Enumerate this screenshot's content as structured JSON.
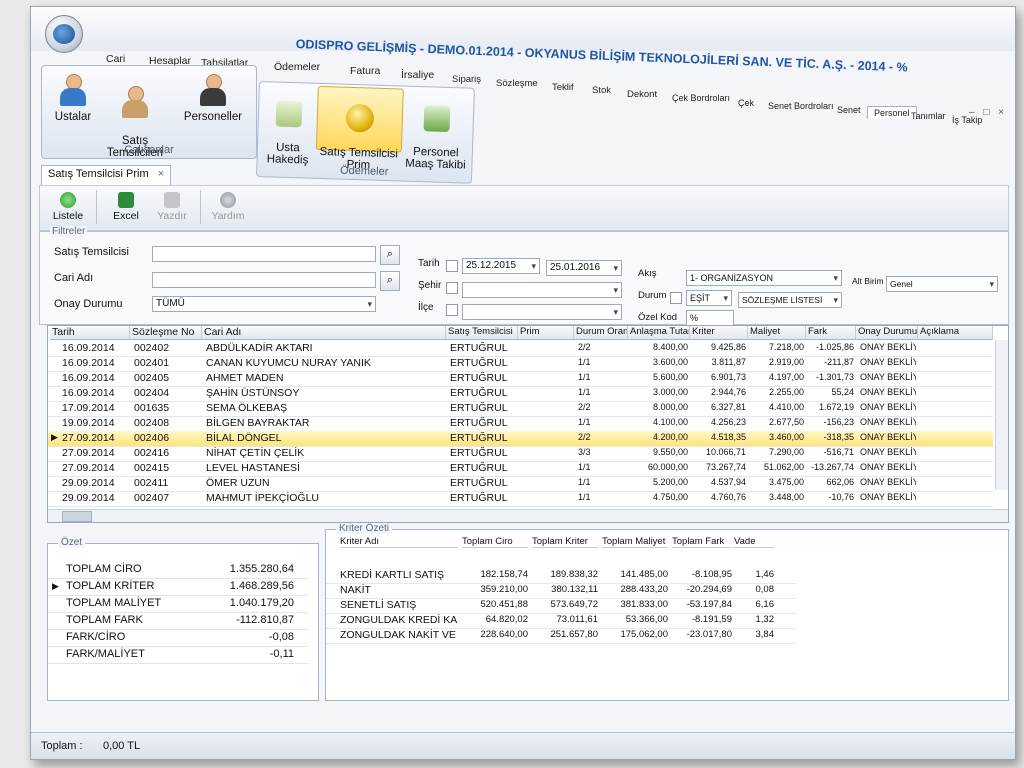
{
  "title": "ODISPRO GELİŞMİŞ - DEMO.01.2014 - OKYANUS BİLİŞİM TEKNOLOJİLERİ SAN. VE TİC. A.Ş. - 2014 - %",
  "window_controls": "– □ ×",
  "main_tabs": [
    "Cari",
    "Hesaplar",
    "Tahsilatlar",
    "Ödemeler",
    "Fatura",
    "İrsaliye",
    "Sipariş",
    "Sözleşme",
    "Teklif",
    "Stok",
    "Dekont",
    "Çek Bordroları",
    "Çek",
    "Senet Bordroları",
    "Senet",
    "Personel",
    "Tanımlar",
    "İş Takip"
  ],
  "active_main_tab": "Personel",
  "ribbon": {
    "group1": {
      "label": "Çalışanlar",
      "buttons": [
        "Ustalar",
        "Satış\nTemsilcileri",
        "Personeller"
      ]
    },
    "group2": {
      "label": "Ödemeler",
      "buttons": [
        "Usta\nHakediş",
        "Satış Temsilcisi\nPrim",
        "Personel\nMaaş Takibi"
      ]
    }
  },
  "doc_tab": {
    "label": "Satış Temsilcisi Prim",
    "close": "×"
  },
  "toolbar": {
    "list": "Listele",
    "excel": "Excel",
    "print": "Yazdır",
    "help": "Yardım"
  },
  "filters": {
    "legend": "Filtreler",
    "sales_rep_label": "Satış Temsilcisi",
    "account_label": "Cari Adı",
    "approval_label": "Onay Durumu",
    "approval_value": "TÜMÜ",
    "date_label": "Tarih",
    "date_from": "25.12.2015",
    "date_to": "25.01.2016",
    "city_label": "Şehir",
    "district_label": "İlçe",
    "flow_label": "Akış",
    "flow_value": "1- ORGANİZASYON",
    "status_label": "Durum",
    "status_op": "EŞİT",
    "status_value": "SÖZLEŞME LİSTESİ",
    "special_code_label": "Özel Kod",
    "special_code_value": "%",
    "unit_label": "Alt Birim",
    "unit_value": "Genel"
  },
  "grid": {
    "columns": [
      "Tarih",
      "Sözleşme No",
      "Cari Adı",
      "Satış Temsilcisi",
      "Prim",
      "Durum Oranı",
      "Anlaşma Tutarı",
      "Kriter",
      "Maliyet",
      "Fark",
      "Onay Durumu",
      "Açıklama"
    ],
    "rows": [
      [
        "16.09.2014",
        "002402",
        "ABDÜLKADİR AKTARI",
        "ERTUĞRUL",
        "",
        "2/2",
        "8.400,00",
        "9.425,86",
        "7.218,00",
        "-1.025,86",
        "ONAY BEKLİYOR",
        ""
      ],
      [
        "16.09.2014",
        "002401",
        "CANAN KUYUMCU NURAY YANIK",
        "ERTUĞRUL",
        "",
        "1/1",
        "3.600,00",
        "3.811,87",
        "2.919,00",
        "-211,87",
        "ONAY BEKLİYOR",
        ""
      ],
      [
        "16.09.2014",
        "002405",
        "AHMET MADEN",
        "ERTUĞRUL",
        "",
        "1/1",
        "5.600,00",
        "6.901,73",
        "4.197,00",
        "-1.301,73",
        "ONAY BEKLİYOR",
        ""
      ],
      [
        "16.09.2014",
        "002404",
        "ŞAHİN ÜSTÜNSOY",
        "ERTUĞRUL",
        "",
        "1/1",
        "3.000,00",
        "2.944,76",
        "2.255,00",
        "55,24",
        "ONAY BEKLİYOR",
        ""
      ],
      [
        "17.09.2014",
        "001635",
        "SEMA ÖLKEBAŞ",
        "ERTUĞRUL",
        "",
        "2/2",
        "8.000,00",
        "6.327,81",
        "4.410,00",
        "1.672,19",
        "ONAY BEKLİYOR",
        ""
      ],
      [
        "19.09.2014",
        "002408",
        "BİLGEN BAYRAKTAR",
        "ERTUĞRUL",
        "",
        "1/1",
        "4.100,00",
        "4.256,23",
        "2.677,50",
        "-156,23",
        "ONAY BEKLİYOR",
        ""
      ],
      [
        "27.09.2014",
        "002406",
        "BİLAL DÖNGEL",
        "ERTUĞRUL",
        "",
        "2/2",
        "4.200,00",
        "4.518,35",
        "3.460,00",
        "-318,35",
        "ONAY BEKLİYOR",
        ""
      ],
      [
        "27.09.2014",
        "002416",
        "NİHAT ÇETİN ÇELİK",
        "ERTUĞRUL",
        "",
        "3/3",
        "9.550,00",
        "10.066,71",
        "7.290,00",
        "-516,71",
        "ONAY BEKLİYOR",
        ""
      ],
      [
        "27.09.2014",
        "002415",
        "LEVEL HASTANESİ",
        "ERTUĞRUL",
        "",
        "1/1",
        "60.000,00",
        "73.267,74",
        "51.062,00",
        "-13.267,74",
        "ONAY BEKLİYOR",
        ""
      ],
      [
        "29.09.2014",
        "002411",
        "ÖMER UZUN",
        "ERTUĞRUL",
        "",
        "1/1",
        "5.200,00",
        "4.537,94",
        "3.475,00",
        "662,06",
        "ONAY BEKLİYOR",
        ""
      ],
      [
        "29.09.2014",
        "002407",
        "MAHMUT İPEKÇİOĞLU",
        "ERTUĞRUL",
        "",
        "1/1",
        "4.750,00",
        "4.760,76",
        "3.448,00",
        "-10,76",
        "ONAY BEKLİYOR",
        ""
      ]
    ],
    "selected_index": 6
  },
  "summary": {
    "title": "Özet",
    "rows": [
      {
        "label": "TOPLAM CİRO",
        "value": "1.355.280,64"
      },
      {
        "label": "TOPLAM KRİTER",
        "value": "1.468.289,56"
      },
      {
        "label": "TOPLAM MALİYET",
        "value": "1.040.179,20"
      },
      {
        "label": "TOPLAM FARK",
        "value": "-112.810,87"
      },
      {
        "label": "FARK/CİRO",
        "value": "-0,08"
      },
      {
        "label": "FARK/MALİYET",
        "value": "-0,11"
      }
    ]
  },
  "criteria": {
    "title": "Kriter Özeti",
    "columns": [
      "Kriter Adı",
      "Toplam Ciro",
      "Toplam Kriter",
      "Toplam Maliyet",
      "Toplam Fark",
      "Vade"
    ],
    "rows": [
      [
        "KREDİ KARTLI SATIŞ",
        "182.158,74",
        "189.838,32",
        "141.485,00",
        "-8.108,95",
        "1,46"
      ],
      [
        "NAKİT",
        "359.210,00",
        "380.132,11",
        "288.433,20",
        "-20.294,69",
        "0,08"
      ],
      [
        "SENETLİ SATIŞ",
        "520.451,88",
        "573.649,72",
        "381.833,00",
        "-53.197,84",
        "6,16"
      ],
      [
        "ZONGULDAK KREDİ KAR",
        "64.820,02",
        "73.011,61",
        "53.366,00",
        "-8.191,59",
        "1,32"
      ],
      [
        "ZONGULDAK NAKİT VE S",
        "228.640,00",
        "251.657,80",
        "175.062,00",
        "-23.017,80",
        "3,84"
      ]
    ]
  },
  "status": {
    "label": "Toplam :",
    "value": "0,00 TL"
  },
  "colors": {
    "accent": "#1f55a8",
    "selection": "#ffe37a"
  },
  "icons": [
    "app-orb-icon",
    "mechanic-icon",
    "sales-rep-icon",
    "employee-icon",
    "payment-icon",
    "coin-icon",
    "salary-icon",
    "refresh-icon",
    "excel-icon",
    "printer-icon",
    "help-icon",
    "search-icon"
  ]
}
